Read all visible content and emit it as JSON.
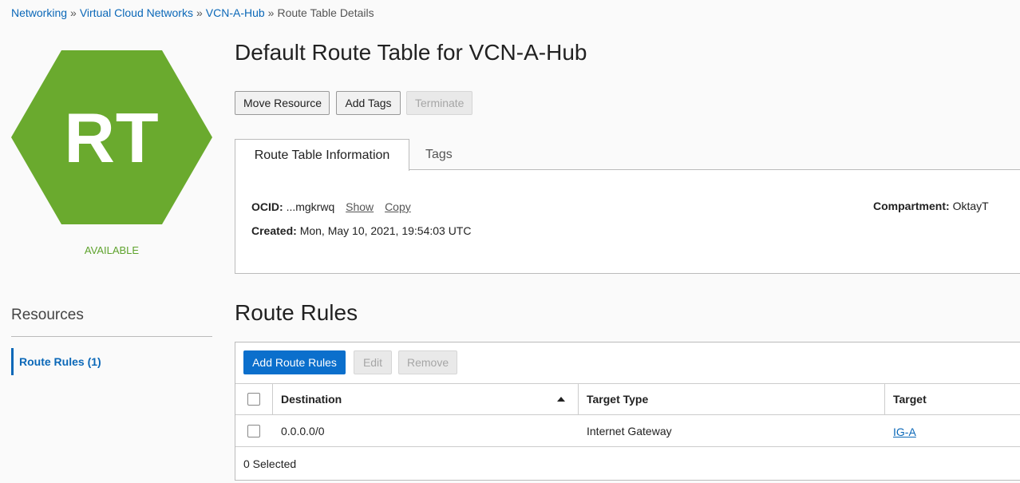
{
  "breadcrumb": {
    "items": [
      "Networking",
      "Virtual Cloud Networks",
      "VCN-A-Hub"
    ],
    "separator": "»",
    "current": "Route Table Details"
  },
  "resource_icon": {
    "initials": "RT",
    "state": "AVAILABLE",
    "color": "#6aaa2e"
  },
  "title": "Default Route Table for VCN-A-Hub",
  "actions": {
    "move_resource": "Move Resource",
    "add_tags": "Add Tags",
    "terminate": "Terminate"
  },
  "tabs": [
    "Route Table Information",
    "Tags"
  ],
  "info": {
    "ocid_label": "OCID:",
    "ocid_value": "...mgkrwq",
    "show_link": "Show",
    "copy_link": "Copy",
    "created_label": "Created:",
    "created_value": "Mon, May 10, 2021, 19:54:03 UTC",
    "compartment_label": "Compartment:",
    "compartment_value": "OktayT"
  },
  "resources": {
    "title": "Resources",
    "items": [
      "Route Rules (1)"
    ]
  },
  "route_rules": {
    "title": "Route Rules",
    "buttons": {
      "add": "Add Route Rules",
      "edit": "Edit",
      "remove": "Remove"
    },
    "columns": [
      "Destination",
      "Target Type",
      "Target"
    ],
    "rows": [
      {
        "destination": "0.0.0.0/0",
        "target_type": "Internet Gateway",
        "target": "IG-A"
      }
    ],
    "selected_count": "0 Selected"
  },
  "colors": {
    "link": "#0b68b8",
    "primary_button": "#0b6fcc",
    "available_green": "#5fa32e"
  }
}
